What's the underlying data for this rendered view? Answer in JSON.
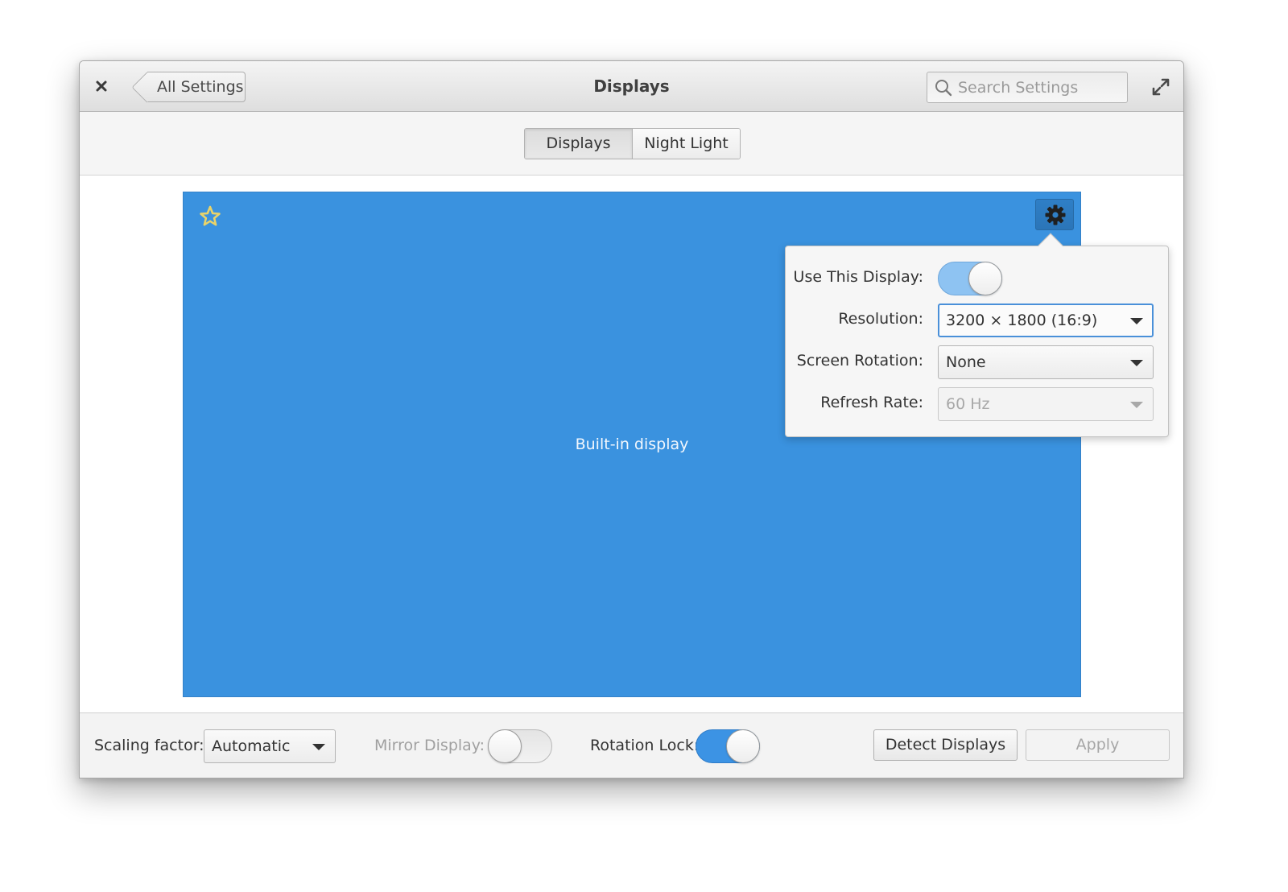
{
  "window": {
    "title": "Displays"
  },
  "header": {
    "back_label": "All Settings",
    "search_placeholder": "Search Settings"
  },
  "tabs": [
    {
      "label": "Displays",
      "active": true
    },
    {
      "label": "Night Light",
      "active": false
    }
  ],
  "display": {
    "name": "Built-in display",
    "primary": true
  },
  "popover": {
    "use_display": {
      "label": "Use This Display:",
      "on": true
    },
    "resolution": {
      "label": "Resolution:",
      "value": "3200 × 1800 (16:9)"
    },
    "rotation": {
      "label": "Screen Rotation:",
      "value": "None"
    },
    "refresh": {
      "label": "Refresh Rate:",
      "value": "60 Hz",
      "enabled": false
    }
  },
  "footer": {
    "scaling_label": "Scaling factor:",
    "scaling_value": "Automatic",
    "mirror_label": "Mirror Display:",
    "mirror_on": false,
    "rotation_lock_label": "Rotation Lock:",
    "rotation_lock_on": true,
    "detect_label": "Detect Displays",
    "apply_label": "Apply"
  },
  "colors": {
    "display_blue": "#3a92df",
    "switch_on": "#3c93e4",
    "star": "#e8d36a"
  }
}
